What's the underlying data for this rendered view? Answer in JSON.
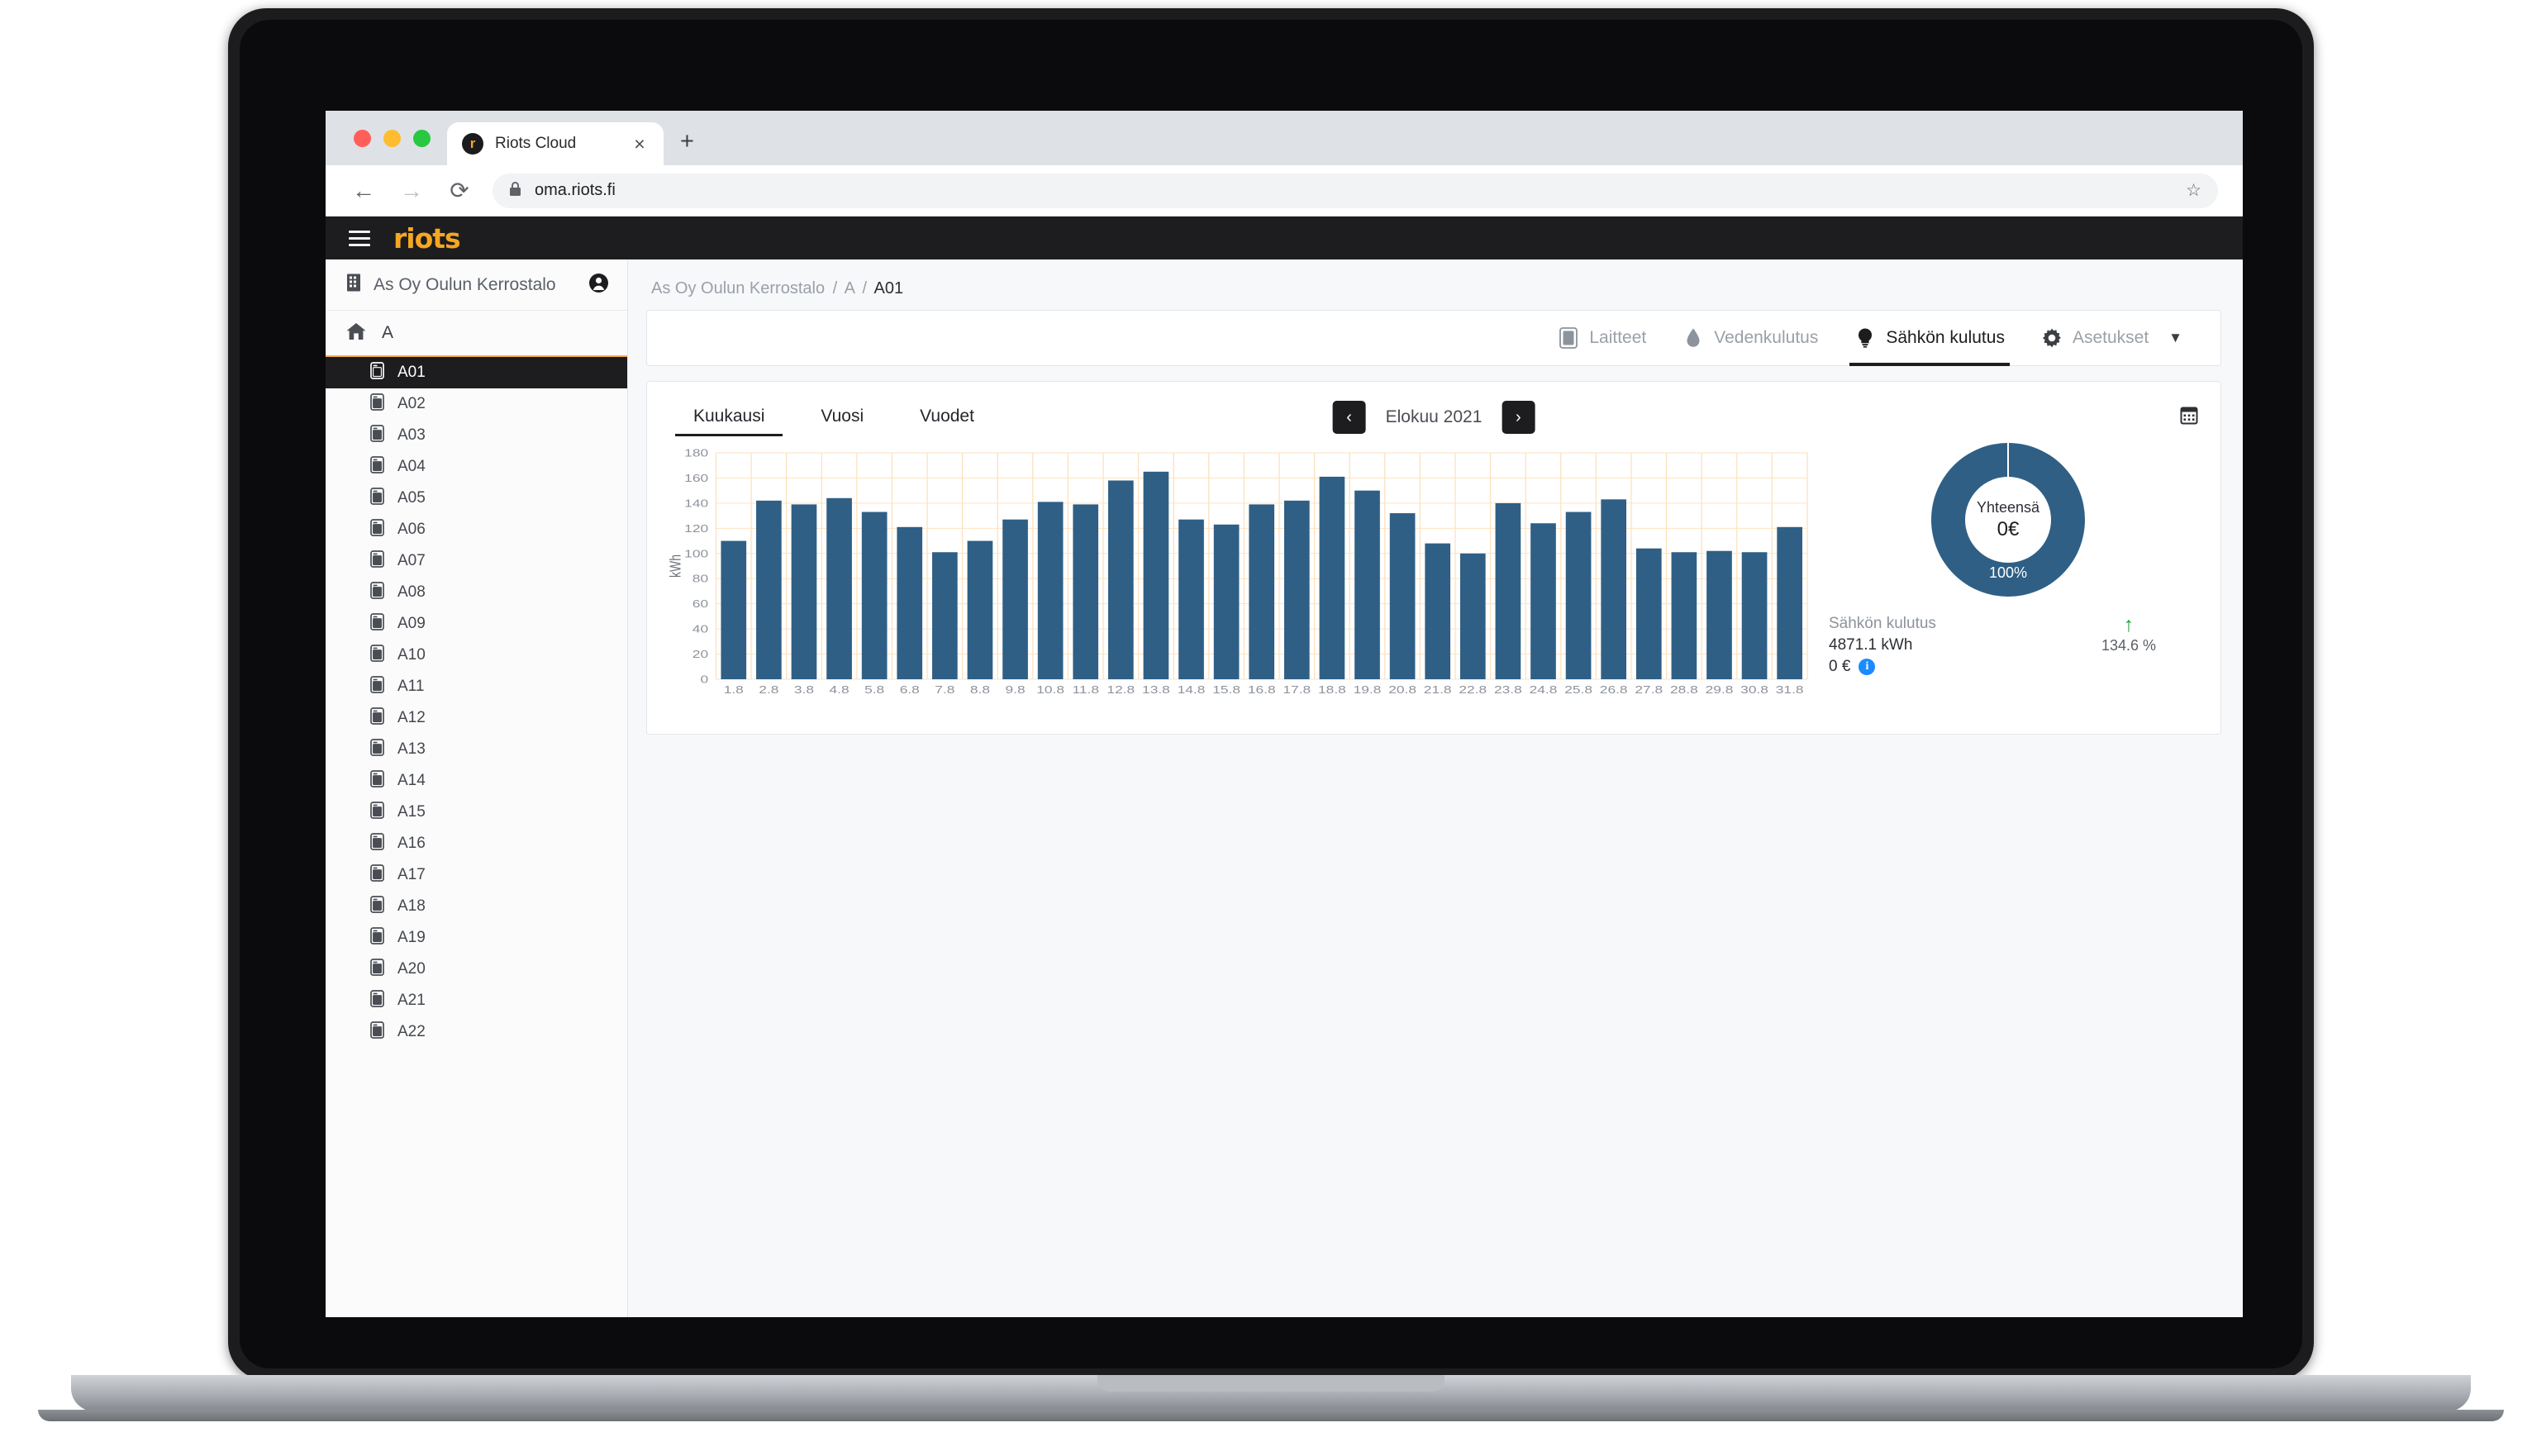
{
  "browser": {
    "tab_title": "Riots Cloud",
    "favicon_letter": "r",
    "close_label": "×",
    "new_tab_label": "+",
    "back_label": "←",
    "forward_label": "→",
    "reload_label": "⟳",
    "lock_label": "🔒",
    "url": "oma.riots.fi",
    "star_label": "☆"
  },
  "app": {
    "brand": "riots",
    "menu_label": "menu-toggle"
  },
  "sidebar": {
    "site_name": "As Oy Oulun Kerrostalo",
    "account_icon": "account-icon",
    "group_label": "A",
    "home_icon": "home-icon",
    "units": [
      {
        "label": "A01",
        "active": true
      },
      {
        "label": "A02",
        "active": false
      },
      {
        "label": "A03",
        "active": false
      },
      {
        "label": "A04",
        "active": false
      },
      {
        "label": "A05",
        "active": false
      },
      {
        "label": "A06",
        "active": false
      },
      {
        "label": "A07",
        "active": false
      },
      {
        "label": "A08",
        "active": false
      },
      {
        "label": "A09",
        "active": false
      },
      {
        "label": "A10",
        "active": false
      },
      {
        "label": "A11",
        "active": false
      },
      {
        "label": "A12",
        "active": false
      },
      {
        "label": "A13",
        "active": false
      },
      {
        "label": "A14",
        "active": false
      },
      {
        "label": "A15",
        "active": false
      },
      {
        "label": "A16",
        "active": false
      },
      {
        "label": "A17",
        "active": false
      },
      {
        "label": "A18",
        "active": false
      },
      {
        "label": "A19",
        "active": false
      },
      {
        "label": "A20",
        "active": false
      },
      {
        "label": "A21",
        "active": false
      },
      {
        "label": "A22",
        "active": false
      }
    ]
  },
  "breadcrumb": {
    "root": "As Oy Oulun Kerrostalo",
    "group": "A",
    "current": "A01",
    "sep": "/"
  },
  "nav_tabs": [
    {
      "label": "Laitteet",
      "icon": "device-icon",
      "active": false
    },
    {
      "label": "Vedenkulutus",
      "icon": "water-drop-icon",
      "active": false
    },
    {
      "label": "Sähkön kulutus",
      "icon": "lightbulb-icon",
      "active": true
    },
    {
      "label": "Asetukset",
      "icon": "gear-icon",
      "active": false
    }
  ],
  "nav_tabs_caret": "▼",
  "chart_toolbar": {
    "range_tabs": [
      {
        "label": "Kuukausi",
        "active": true
      },
      {
        "label": "Vuosi",
        "active": false
      },
      {
        "label": "Vuodet",
        "active": false
      }
    ],
    "prev_label": "‹",
    "next_label": "›",
    "period": "Elokuu 2021",
    "calendar_icon": "calendar-icon"
  },
  "donut": {
    "center_label": "Yhteensä",
    "center_value": "0€",
    "slice_pct": "100%"
  },
  "stats": {
    "title": "Sähkön kulutus",
    "kwh": "4871.1 kWh",
    "eur": "0 €",
    "info_label": "i",
    "trend_arrow": "↑",
    "trend_pct": "134.6 %"
  },
  "colors": {
    "bar": "#2f5f85",
    "grid": "#fde2c0",
    "accent": "#f5a623",
    "dark": "#1d1d1f",
    "trend_up": "#23a03c",
    "info": "#1a8cff"
  },
  "chart_data": {
    "type": "bar",
    "title": "",
    "xlabel": "",
    "ylabel": "kWh",
    "ylim": [
      0,
      180
    ],
    "yticks": [
      0,
      20,
      40,
      60,
      80,
      100,
      120,
      140,
      160,
      180
    ],
    "grid": true,
    "legend": "none",
    "categories": [
      "1.8",
      "2.8",
      "3.8",
      "4.8",
      "5.8",
      "6.8",
      "7.8",
      "8.8",
      "9.8",
      "10.8",
      "11.8",
      "12.8",
      "13.8",
      "14.8",
      "15.8",
      "16.8",
      "17.8",
      "18.8",
      "19.8",
      "20.8",
      "21.8",
      "22.8",
      "23.8",
      "24.8",
      "25.8",
      "26.8",
      "27.8",
      "28.8",
      "29.8",
      "30.8",
      "31.8"
    ],
    "values": [
      110,
      142,
      139,
      144,
      133,
      121,
      101,
      110,
      127,
      141,
      139,
      158,
      165,
      127,
      123,
      139,
      142,
      161,
      150,
      132,
      108,
      100,
      140,
      124,
      133,
      143,
      104,
      101,
      102,
      101,
      121
    ],
    "unit": "kWh"
  }
}
